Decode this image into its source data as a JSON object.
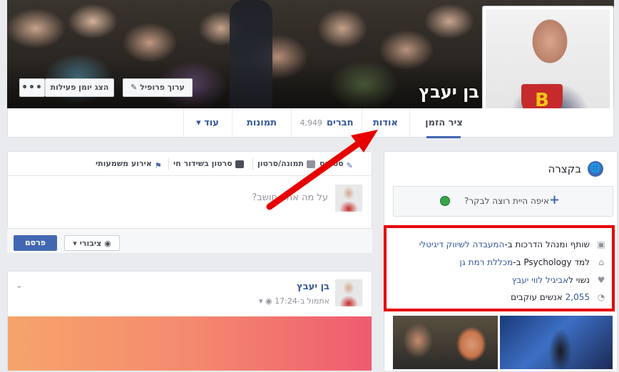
{
  "profile": {
    "name": "בן יעבץ"
  },
  "cover_buttons": {
    "edit_profile": "ערוך פרופיל",
    "activity_log": "הצג יומן פעילות",
    "more": "•••"
  },
  "nav": {
    "timeline": "ציר הזמן",
    "about": "אודות",
    "friends": "חברים",
    "friends_count": "4,949",
    "photos": "תמונות",
    "more": "עוד ▾"
  },
  "intro": {
    "title": "בקצרה",
    "where_prompt": "איפה היית רוצה לבקר?",
    "work_prefix": "שותף ומנהל הדרכות ב-",
    "work_link": "המעבדה לשיווק דיגיטלי",
    "study_prefix": "למד Psychology ב-",
    "study_link": "מכללת רמת גן",
    "married_prefix": "נשוי ל",
    "married_link": "אביגיל לווי יעבץ",
    "followers_count": "2,055",
    "followers_suffix": "אנשים עוקבים"
  },
  "composer": {
    "tab_status": "סטטוס",
    "tab_photo": "תמונה/סרטון",
    "tab_live": "סרטון בשידור חי",
    "tab_event": "אירוע משמעותי",
    "prompt": "על מה אתה חושב?",
    "audience": "ציבורי",
    "post_button": "פרסם"
  },
  "post": {
    "author": "בן יעבץ",
    "time": "אתמול ב-17:24"
  },
  "colors": {
    "facebook_blue": "#4267b2",
    "link": "#365899",
    "highlight_red": "#e60000",
    "background": "#e9ebee"
  }
}
